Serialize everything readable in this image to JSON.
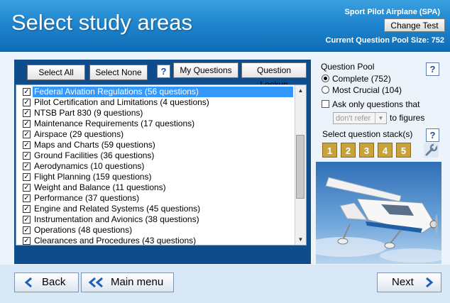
{
  "header": {
    "title": "Select study areas",
    "test_name": "Sport Pilot Airplane (SPA)",
    "change_test": "Change Test",
    "pool_size": "Current Question Pool Size: 752"
  },
  "toolbar": {
    "select_all": "Select All",
    "select_none": "Select None",
    "help": "?",
    "my_questions": "My Questions",
    "question_lookup": "Question Lookup"
  },
  "study_areas": [
    {
      "label": "Federal Aviation Regulations (56 questions)",
      "checked": true,
      "selected": true
    },
    {
      "label": "Pilot Certification and Limitations (4 questions)",
      "checked": true
    },
    {
      "label": "NTSB Part 830 (9 questions)",
      "checked": true
    },
    {
      "label": "Maintenance Requirements (17 questions)",
      "checked": true
    },
    {
      "label": "Airspace (29 questions)",
      "checked": true
    },
    {
      "label": "Maps and Charts (59 questions)",
      "checked": true
    },
    {
      "label": "Ground Facilities (36 questions)",
      "checked": true
    },
    {
      "label": "Aerodynamics (10 questions)",
      "checked": true
    },
    {
      "label": "Flight Planning (159 questions)",
      "checked": true
    },
    {
      "label": "Weight and Balance (11 questions)",
      "checked": true
    },
    {
      "label": "Performance (37 questions)",
      "checked": true
    },
    {
      "label": "Engine and Related Systems (45 questions)",
      "checked": true
    },
    {
      "label": "Instrumentation and Avionics (38 questions)",
      "checked": true
    },
    {
      "label": "Operations (48 questions)",
      "checked": true
    },
    {
      "label": "Clearances and Procedures (43 questions)",
      "checked": true
    }
  ],
  "pool": {
    "heading": "Question Pool",
    "complete": "Complete (752)",
    "most_crucial": "Most Crucial (104)",
    "selected": "complete",
    "ask_only": "Ask only questions that",
    "refer_select": "don't refer",
    "to_figures": "to figures"
  },
  "stacks": {
    "heading": "Select question stack(s)",
    "numbers": [
      "1",
      "2",
      "3",
      "4",
      "5"
    ]
  },
  "nav": {
    "back": "Back",
    "main_menu": "Main menu",
    "next": "Next"
  },
  "colors": {
    "header_blue": "#1f86cf",
    "panel_navy": "#0f4c8c",
    "stack_gold": "#c8a23a",
    "selection_blue": "#3399ff"
  },
  "icons": {
    "help": "question-mark-icon",
    "wrench": "wrench-icon",
    "back": "chevron-left-icon",
    "main_menu": "double-chevron-left-icon",
    "next": "chevron-right-icon"
  }
}
